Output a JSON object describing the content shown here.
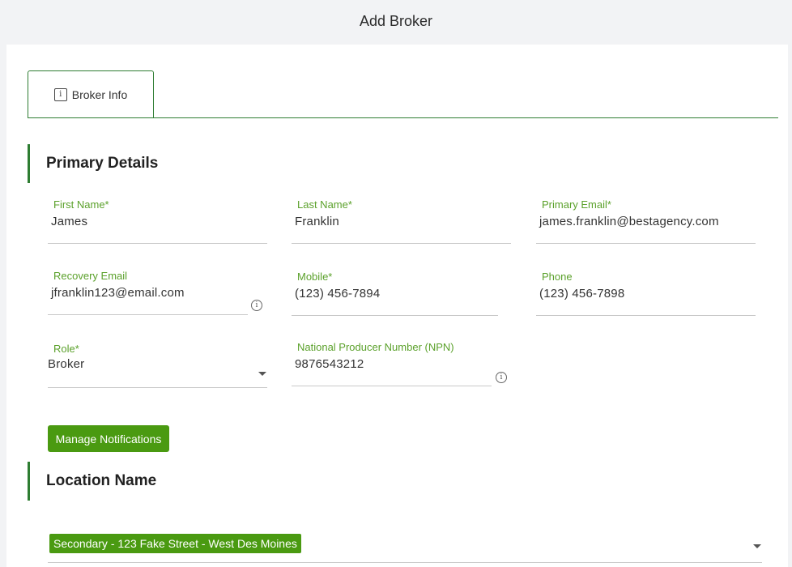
{
  "header": {
    "title": "Add Broker"
  },
  "tabs": [
    {
      "label": "Broker Info",
      "icon": "info-box-icon"
    }
  ],
  "primary_details": {
    "title": "Primary Details",
    "first_name": {
      "label": "First Name*",
      "value": "James"
    },
    "last_name": {
      "label": "Last Name*",
      "value": "Franklin"
    },
    "primary_email": {
      "label": "Primary Email*",
      "value": "james.franklin@bestagency.com"
    },
    "recovery_email": {
      "label": "Recovery Email",
      "value": "jfranklin123@email.com"
    },
    "mobile": {
      "label": "Mobile*",
      "value": "(123) 456-7894"
    },
    "phone": {
      "label": "Phone",
      "value": "(123) 456-7898"
    },
    "role": {
      "label": "Role*",
      "value": "Broker"
    },
    "npn": {
      "label": "National Producer Number (NPN)",
      "value": "9876543212"
    },
    "manage_notifications_label": "Manage Notifications"
  },
  "location": {
    "title": "Location Name",
    "selected": [
      "Secondary - 123 Fake Street - West Des Moines"
    ]
  },
  "colors": {
    "accent": "#2e7d32",
    "button": "#4a9a11",
    "label": "#5ba12b"
  }
}
